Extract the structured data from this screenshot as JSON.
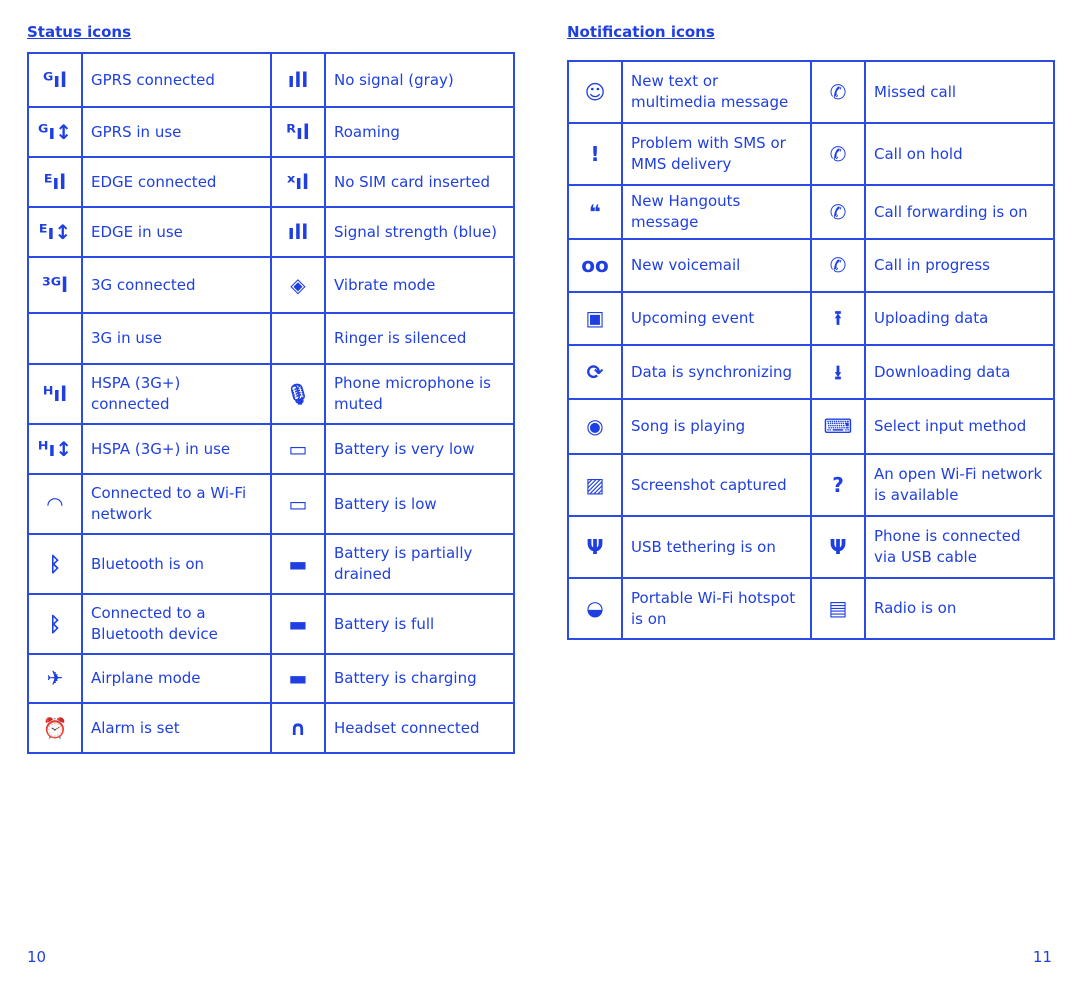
{
  "left": {
    "heading": "Status icons",
    "rows": [
      [
        {
          "icon": "signal-g-icon",
          "label": "GPRS connected"
        },
        {
          "icon": "signal-gray-icon",
          "label": "No signal (gray)"
        }
      ],
      [
        {
          "icon": "signal-g-inuse-icon",
          "label": "GPRS in use"
        },
        {
          "icon": "signal-roaming-icon",
          "label": "Roaming"
        }
      ],
      [
        {
          "icon": "signal-e-icon",
          "label": "EDGE connected"
        },
        {
          "icon": "signal-no-sim-icon",
          "label": "No SIM card inserted"
        }
      ],
      [
        {
          "icon": "signal-e-inuse-icon",
          "label": "EDGE in use"
        },
        {
          "icon": "signal-blue-icon",
          "label": "Signal strength (blue)"
        }
      ],
      [
        {
          "icon": "signal-3g-icon",
          "label": "3G connected"
        },
        {
          "icon": "vibrate-icon",
          "label": "Vibrate mode"
        }
      ],
      [
        {
          "icon": "",
          "label": "3G in use"
        },
        {
          "icon": "",
          "label": "Ringer is silenced"
        }
      ],
      [
        {
          "icon": "signal-h-icon",
          "label": "HSPA (3G+) connected"
        },
        {
          "icon": "mic-muted-icon",
          "label": "Phone microphone is muted"
        }
      ],
      [
        {
          "icon": "signal-h-inuse-icon",
          "label": "HSPA (3G+) in use"
        },
        {
          "icon": "battery-very-low-icon",
          "label": "Battery is very low"
        }
      ],
      [
        {
          "icon": "wifi-icon",
          "label": "Connected to a Wi-Fi network"
        },
        {
          "icon": "battery-low-icon",
          "label": "Battery is low"
        }
      ],
      [
        {
          "icon": "bluetooth-icon",
          "label": "Bluetooth is on"
        },
        {
          "icon": "battery-partial-icon",
          "label": "Battery is partially drained"
        }
      ],
      [
        {
          "icon": "bluetooth-connected-icon",
          "label": "Connected to a Bluetooth device"
        },
        {
          "icon": "battery-full-icon",
          "label": "Battery is full"
        }
      ],
      [
        {
          "icon": "airplane-icon",
          "label": "Airplane mode"
        },
        {
          "icon": "battery-charging-icon",
          "label": "Battery is charging"
        }
      ],
      [
        {
          "icon": "alarm-icon",
          "label": "Alarm is set"
        },
        {
          "icon": "headset-icon",
          "label": "Headset connected"
        }
      ]
    ],
    "page_number": "10"
  },
  "right": {
    "heading": "Notification icons",
    "rows": [
      [
        {
          "icon": "message-icon",
          "label": "New text or multimedia message"
        },
        {
          "icon": "missed-call-icon",
          "label": "Missed call"
        }
      ],
      [
        {
          "icon": "sms-problem-icon",
          "label": "Problem with SMS or MMS delivery"
        },
        {
          "icon": "call-hold-icon",
          "label": "Call on hold"
        }
      ],
      [
        {
          "icon": "hangouts-icon",
          "label": "New Hangouts message"
        },
        {
          "icon": "call-forward-icon",
          "label": "Call forwarding is on"
        }
      ],
      [
        {
          "icon": "voicemail-icon",
          "label": "New voicemail"
        },
        {
          "icon": "phone-icon",
          "label": "Call in progress"
        }
      ],
      [
        {
          "icon": "calendar-icon",
          "label": "Upcoming event"
        },
        {
          "icon": "upload-icon",
          "label": "Uploading data"
        }
      ],
      [
        {
          "icon": "sync-icon",
          "label": "Data is synchronizing"
        },
        {
          "icon": "download-icon",
          "label": "Downloading data"
        }
      ],
      [
        {
          "icon": "music-disc-icon",
          "label": "Song is playing"
        },
        {
          "icon": "keyboard-icon",
          "label": "Select input method"
        }
      ],
      [
        {
          "icon": "screenshot-icon",
          "label": "Screenshot captured"
        },
        {
          "icon": "open-wifi-icon",
          "label": "An open Wi-Fi network is available"
        }
      ],
      [
        {
          "icon": "usb-tethering-icon",
          "label": "USB tethering is on"
        },
        {
          "icon": "usb-icon",
          "label": "Phone is connected via USB cable"
        }
      ],
      [
        {
          "icon": "hotspot-icon",
          "label": "Portable Wi-Fi hotspot is on"
        },
        {
          "icon": "radio-icon",
          "label": "Radio is on"
        }
      ]
    ],
    "page_number": "11"
  },
  "colors": {
    "text": "#1f3fe0",
    "border": "#2a4be6"
  }
}
